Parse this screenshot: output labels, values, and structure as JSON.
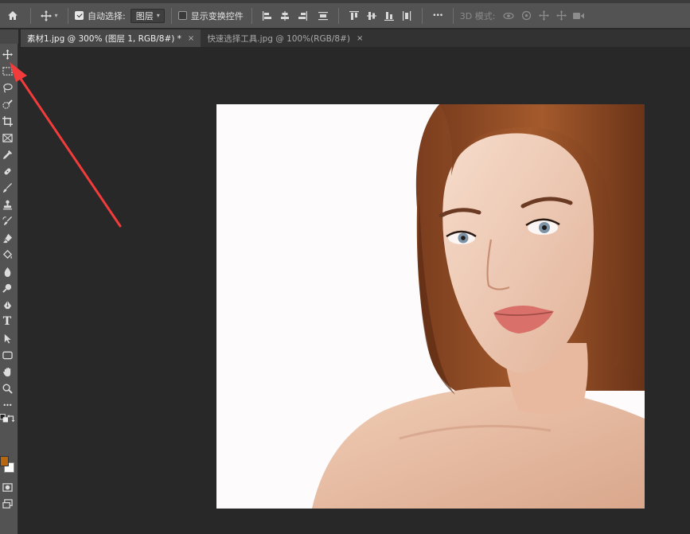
{
  "options_bar": {
    "auto_select_label": "自动选择:",
    "auto_select_checked": true,
    "auto_select_value": "图层",
    "show_transform_label": "显示变换控件",
    "show_transform_checked": false,
    "mode_3d_label": "3D 模式:"
  },
  "tabs": [
    {
      "label": "素材1.jpg @ 300% (图层 1, RGB/8#) *",
      "active": true
    },
    {
      "label": "快速选择工具.jpg @ 100%(RGB/8#)",
      "active": false
    }
  ],
  "tab_close_glyph": "×",
  "colors": {
    "foreground": "#b8660f",
    "background": "#ffffff",
    "annotation_arrow": "#f23b3b",
    "hair": "#8a4a26"
  },
  "toolbar_tools": [
    "move-tool",
    "marquee-tool",
    "lasso-tool",
    "quick-selection-tool",
    "crop-tool",
    "frame-tool",
    "eyedropper-tool",
    "healing-brush-tool",
    "brush-tool",
    "clone-stamp-tool",
    "history-brush-tool",
    "eraser-tool",
    "paint-bucket-tool",
    "blur-tool",
    "dodge-tool",
    "pen-tool",
    "type-tool",
    "path-selection-tool",
    "shape-tool",
    "hand-tool",
    "zoom-tool",
    "more-tools"
  ],
  "type_tool_glyph": "T",
  "more_glyph": "•••",
  "document_image": "portrait-photo"
}
